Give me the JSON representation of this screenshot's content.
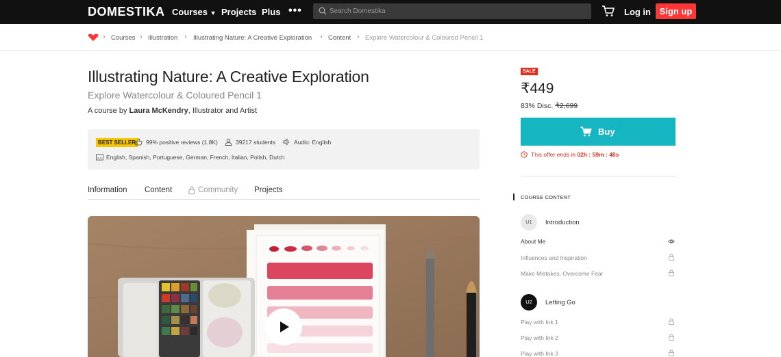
{
  "header": {
    "logo": "DOMESTIKA",
    "nav": {
      "courses": "Courses",
      "projects": "Projects",
      "plus": "Plus",
      "more": "•••"
    },
    "search_placeholder": "Search Domestika",
    "login": "Log in",
    "signup": "Sign up"
  },
  "breadcrumb": {
    "items": [
      "Courses",
      "Illustration",
      "Illustrating Nature: A Creative Exploration",
      "Content",
      "Explore Watercolour & Coloured Pencil 1"
    ]
  },
  "course": {
    "title": "Illustrating Nature: A Creative Exploration",
    "subtitle": "Explore Watercolour & Coloured Pencil 1",
    "byline_prefix": "A course by ",
    "author": "Laura McKendry",
    "byline_suffix": ", Illustrator and Artist",
    "badge": "BEST SELLER",
    "reviews": "99% positive reviews (1.8K)",
    "students": "39217 students",
    "audio": "Audio: English",
    "subtitles": "English, Spanish, Portuguese, German, French, Italian, Polish, Dutch"
  },
  "tabs": [
    "Information",
    "Content",
    "Community",
    "Projects"
  ],
  "purchase": {
    "sale_badge": "SALE",
    "price": "₹449",
    "discount": "83% Disc.",
    "old_price": "₹2,699",
    "buy_label": "Buy",
    "offer_prefix": "This offer ends in",
    "offer_time": "02h : 59m : 48s"
  },
  "course_content": {
    "heading": "COURSE CONTENT",
    "units": [
      {
        "code": "U1",
        "title": "Introduction",
        "lessons": [
          {
            "title": "About Me",
            "icon": "eye-icon"
          },
          {
            "title": "Influences and Inspiration",
            "icon": "lock-icon"
          },
          {
            "title": "Make Mistakes, Overcome Fear",
            "icon": "lock-icon"
          }
        ]
      },
      {
        "code": "U2",
        "title": "Letting Go",
        "lessons": [
          {
            "title": "Play with Ink 1",
            "icon": "lock-icon"
          },
          {
            "title": "Play with Ink 2",
            "icon": "lock-icon"
          },
          {
            "title": "Play with Ink 3",
            "icon": "lock-icon"
          }
        ]
      }
    ]
  },
  "colors": {
    "topbar": "#111111",
    "signup": "#ff3636",
    "buy": "#16b5c2",
    "sale": "#e02f1f",
    "best_seller": "#f7c600"
  }
}
